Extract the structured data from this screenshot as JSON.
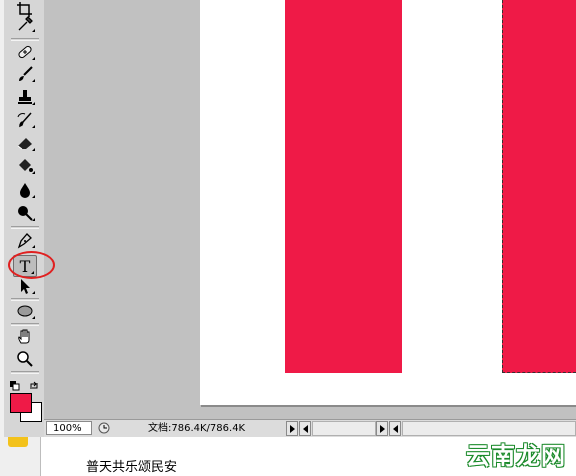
{
  "toolbar": {
    "tools": [
      "crop-icon",
      "eyedropper-icon",
      "healing-brush-icon",
      "brush-icon",
      "clone-stamp-icon",
      "history-brush-icon",
      "eraser-icon",
      "paint-bucket-icon",
      "blur-icon",
      "dodge-icon",
      "pen-icon",
      "type-icon",
      "path-selection-icon",
      "ellipse-icon",
      "hand-icon",
      "zoom-icon"
    ],
    "type_tool_glyph": "T",
    "foreground_color": "#ef1a47",
    "background_color": "#ffffff",
    "highlight_color": "#e02020"
  },
  "canvas": {
    "stripe_color": "#ef1a47",
    "background": "#ffffff"
  },
  "status": {
    "zoom": "100%",
    "doc_info": "文档:786.4K/786.4K"
  },
  "page": {
    "caption": "普天共乐颂民安"
  },
  "watermark": "云南龙网"
}
